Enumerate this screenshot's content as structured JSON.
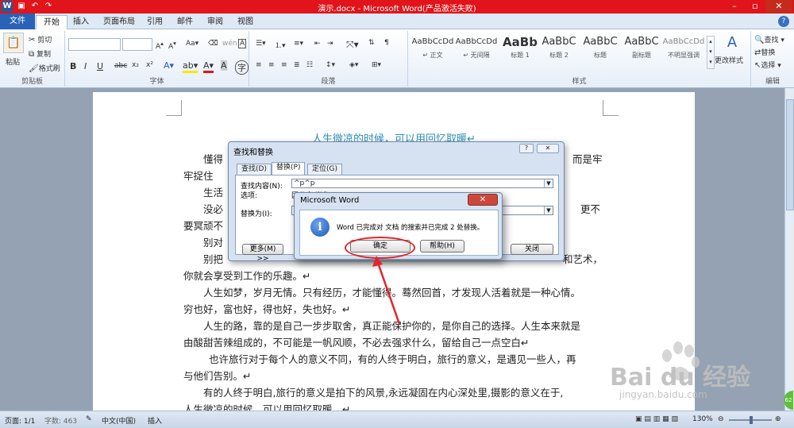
{
  "titlebar": {
    "app_icon": "W",
    "title": "演示.docx - Microsoft Word(产品激活失败)",
    "qa_icons": [
      "save-icon",
      "undo-icon",
      "redo-icon"
    ],
    "win_buttons": [
      "minimize-icon",
      "restore-icon",
      "close-icon"
    ],
    "win_glyphs": [
      "–",
      "▫",
      "✕"
    ]
  },
  "tabs": [
    "文件",
    "开始",
    "插入",
    "页面布局",
    "引用",
    "邮件",
    "审阅",
    "视图"
  ],
  "help_label": "?",
  "ribbon": {
    "clipboard": {
      "paste": "粘贴",
      "cut": "剪切",
      "copy": "复制",
      "painter": "格式刷",
      "group": "剪贴板"
    },
    "font": {
      "group": "字体",
      "bold": "B",
      "italic": "I",
      "underline": "U",
      "strike": "abc",
      "sub": "x₂",
      "sup": "x²"
    },
    "paragraph": {
      "group": "段落"
    },
    "styles": {
      "group": "样式",
      "tiles": [
        {
          "sample": "AaBbCcDd",
          "name": "↵ 正文"
        },
        {
          "sample": "AaBbCcDd",
          "name": "↵ 无间隔"
        },
        {
          "sample": "AaBb",
          "name": "标题 1"
        },
        {
          "sample": "AaBbC",
          "name": "标题 2"
        },
        {
          "sample": "AaBbC",
          "name": "标题"
        },
        {
          "sample": "AaBbC",
          "name": "副标题"
        },
        {
          "sample": "AaBbCcDd",
          "name": "不明显强调"
        }
      ],
      "change": "更改样式"
    },
    "editing": {
      "group": "编辑",
      "find": "查找 ▾",
      "replace": "替换",
      "select": "选择 ▾"
    }
  },
  "document": {
    "title": "人生微凉的时候，可以用回忆取暖↵",
    "paragraphs": [
      "懂得",
      "牢捉住",
      "生活",
      "没必",
      "要冥顽不",
      "别对",
      "别把",
      "你就会享受到工作的乐趣。↵",
      "人生如梦，岁月无情。只有经历，才能懂得。蓦然回首，才发现人活着就是一种心情。",
      "穷也好，富也好，得也好，失也好。↵",
      "人生的路，靠的是自己一步步取舍，真正能保护你的，是你自己的选择。人生本来就是",
      "由酸甜苦辣组成的，不可能是一帆风顺，不必去强求什么，留给自己一点空白↵",
      "也许旅行对于每个人的意义不同，有的人终于明白，旅行的意义，是遇见一些人，再",
      "与他们告别。↵",
      "有的人终于明白,旅行的意义是拍下的风景,永远凝固在内心深处里,摄影的意义在于,",
      "人生微凉的时候，可以用回忆取暖。↵"
    ],
    "right_fragments": [
      "而是牢",
      "更不",
      "和艺术，"
    ]
  },
  "find_replace": {
    "title": "查找和替换",
    "help": "?",
    "close": "✕",
    "tabs": [
      "查找(D)",
      "替换(P)",
      "定位(G)"
    ],
    "find_label": "查找内容(N):",
    "find_value": "^p^p",
    "options_label": "选项:",
    "options_value": "区分全/半角",
    "replace_label": "替换为(I):",
    "replace_value": "^p",
    "more_button": "更多(M) >>",
    "close_button": "关闭"
  },
  "message_box": {
    "title": "Microsoft Word",
    "close": "✕",
    "icon": "i",
    "text": "Word 已完成对 文档 的搜索并已完成 2 处替换。",
    "ok_button": "确定",
    "help_button": "帮助(H)"
  },
  "statusbar": {
    "page": "页面: 1/1",
    "words": "字数: 463",
    "language": "中文(中国)",
    "mode": "插入",
    "zoom": "130%"
  },
  "watermark": {
    "brand": "Bai du 经验",
    "url": "jingyan.baidu.com"
  },
  "colors": {
    "title_bar": "#e0141a",
    "file_tab": "#2a62b8",
    "doc_title": "#2f8fb5",
    "annotation": "#e0262b"
  }
}
